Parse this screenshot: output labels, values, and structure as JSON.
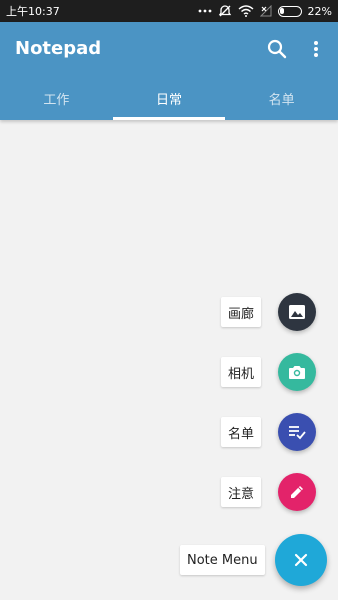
{
  "status_bar": {
    "time": "上午10:37",
    "battery_text": "22%",
    "battery_level": 0.22,
    "icons": [
      "more-dots-icon",
      "silent-icon",
      "wifi-icon",
      "signal-x-icon",
      "battery-icon"
    ]
  },
  "app_bar": {
    "title": "Notepad",
    "background": "#4b94c4",
    "actions": [
      "search-icon",
      "more-vert-icon"
    ]
  },
  "tabs": [
    {
      "label": "工作",
      "active": false
    },
    {
      "label": "日常",
      "active": true
    },
    {
      "label": "名单",
      "active": false
    }
  ],
  "fab_menu": {
    "items": [
      {
        "label": "画廊",
        "icon": "image-icon",
        "color": "#2e3540"
      },
      {
        "label": "相机",
        "icon": "camera-icon",
        "color": "#35b99e"
      },
      {
        "label": "名单",
        "icon": "checklist-icon",
        "color": "#3a4fb0"
      },
      {
        "label": "注意",
        "icon": "pencil-icon",
        "color": "#e3236a"
      }
    ],
    "main_label": "Note Menu",
    "main_icon": "close-icon",
    "main_color": "#1fa8d8"
  }
}
